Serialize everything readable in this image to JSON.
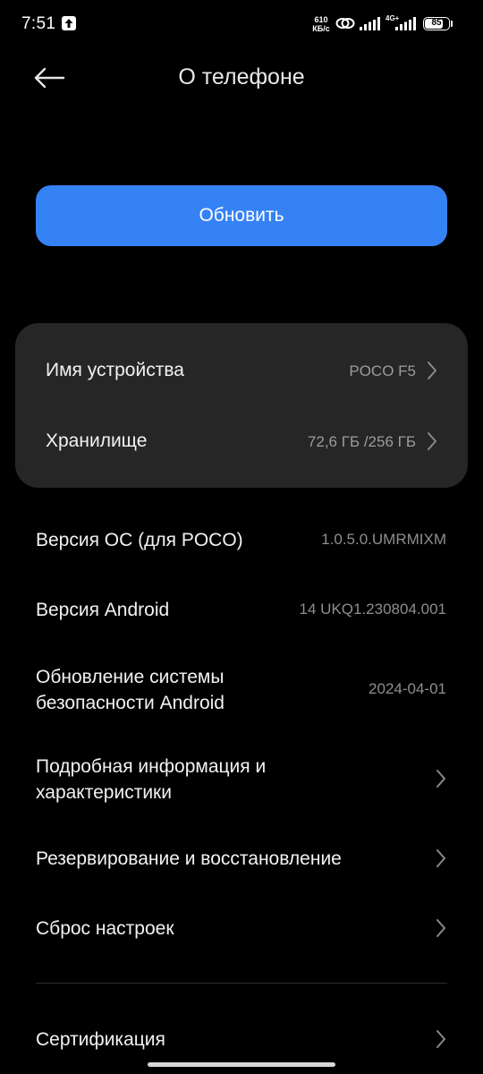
{
  "status_bar": {
    "time": "7:51",
    "net_speed_value": "610",
    "net_speed_unit": "КБ/с",
    "network_type": "4G+",
    "battery_level": "85",
    "battery_fraction": 0.85,
    "icons": [
      "upload-notification-icon",
      "link-icon",
      "signal-icon",
      "signal-icon",
      "battery-icon"
    ]
  },
  "header": {
    "title": "О телефоне",
    "back_icon": "arrow-left-icon"
  },
  "update_button": {
    "label": "Обновить",
    "color": "#3582f5"
  },
  "device_card": {
    "device_name": {
      "label": "Имя устройства",
      "value": "POCO F5"
    },
    "storage": {
      "label": "Хранилище",
      "value": "72,6 ГБ /256 ГБ"
    }
  },
  "info": {
    "os_version": {
      "label": "Версия ОС (для POCO)",
      "value": "1.0.5.0.UMRMIXM"
    },
    "android_version": {
      "label": "Версия Android",
      "value": "14 UKQ1.230804.001"
    },
    "security_update": {
      "label_line1": "Обновление системы",
      "label_line2": "безопасности Android",
      "value": "2024-04-01"
    }
  },
  "menu": {
    "details": {
      "label_line1": "Подробная информация и",
      "label_line2": "характеристики"
    },
    "backup": {
      "label": "Резервирование и восстановление"
    },
    "reset": {
      "label": "Сброс настроек"
    },
    "certification": {
      "label": "Сертификация"
    }
  },
  "colors": {
    "background": "#000000",
    "card": "#262626",
    "accent": "#3582f5",
    "secondary_text": "#9c9c9c"
  }
}
